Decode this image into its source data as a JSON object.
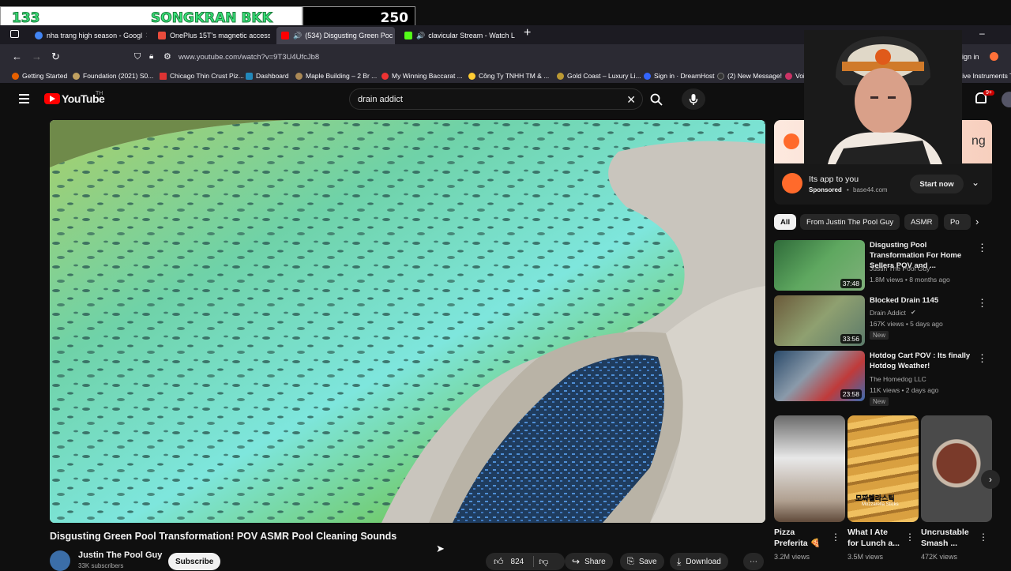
{
  "overlay": {
    "left_number": "133",
    "left_text": "SONGKRAN BKK",
    "right_number": "250"
  },
  "browser": {
    "tabs": [
      {
        "label": "nha trang high season - Googl",
        "color": "#4285f4"
      },
      {
        "label": "OnePlus 15T's magnetic access",
        "color": "#e94b3c"
      },
      {
        "label": "(534) Disgusting Green Poc",
        "color": "#ff0000"
      },
      {
        "label": "clavicular Stream - Watch L",
        "color": "#53fc18"
      }
    ],
    "url": "www.youtube.com/watch?v=9T3U4UfcJb8",
    "sign_in": "Sign in",
    "bookmarks": [
      {
        "label": "Getting Started",
        "color": "#e66000"
      },
      {
        "label": "Foundation (2021) S0...",
        "color": "#c0a060"
      },
      {
        "label": "Chicago Thin Crust Piz...",
        "color": "#d33"
      },
      {
        "label": "Dashboard",
        "color": "#28b"
      },
      {
        "label": "Maple Building – 2 Br ...",
        "color": "#a85"
      },
      {
        "label": "My Winning Baccarat ...",
        "color": "#e33"
      },
      {
        "label": "Công Ty TNHH TM & ...",
        "color": "#fc3"
      },
      {
        "label": "Gold Coast – Luxury Li...",
        "color": "#b93"
      },
      {
        "label": "Sign in · DreamHost",
        "color": "#36f"
      },
      {
        "label": "(2) New Message!",
        "color": "#333"
      },
      {
        "label": "Voice (Korean Dr...",
        "color": "#c36"
      },
      {
        "label": "Native Instruments T",
        "color": "#444"
      }
    ]
  },
  "youtube": {
    "logo": "YouTube",
    "logo_sup": "TH",
    "search_value": "drain addict",
    "notifications_badge": "9+"
  },
  "video": {
    "title": "Disgusting Green Pool Transformation! POV ASMR Pool Cleaning Sounds",
    "channel": "Justin The Pool Guy",
    "subscribers": "33K subscribers",
    "subscribe_label": "Subscribe",
    "like_count": "824",
    "share_label": "Share",
    "save_label": "Save",
    "download_label": "Download"
  },
  "ad": {
    "headline": "Its app to you",
    "sponsored": "Sponsored",
    "domain": "base44.com",
    "cta": "Start now",
    "banner_text": "ng"
  },
  "chips": [
    "All",
    "From Justin The Pool Guy",
    "ASMR",
    "Po"
  ],
  "recommendations": [
    {
      "title": "Disgusting Pool Transformation For Home Sellers POV and ...",
      "channel": "Justin The Pool Guy",
      "meta": "1.8M views • 8 months ago",
      "duration": "37:48",
      "new": ""
    },
    {
      "title": "Blocked Drain 1145",
      "channel": "Drain Addict",
      "meta": "167K views • 5 days ago",
      "duration": "33:56",
      "new": "New"
    },
    {
      "title": "Hotdog Cart POV : Its finally Hotdog Weather!",
      "channel": "The Homedog LLC",
      "meta": "11K views • 2 days ago",
      "duration": "23:58",
      "new": "New"
    }
  ],
  "shorts": [
    {
      "title_line1": "Pizza",
      "title_line2": "Preferita 🍕",
      "views": "3.2M views",
      "overlay": ""
    },
    {
      "title_line1": "What I Ate",
      "title_line2": "for Lunch a...",
      "views": "3.5M views",
      "overlay": "모짜렐라스틱"
    },
    {
      "title_line1": "Uncrustable",
      "title_line2": "Smash ...",
      "views": "472K views",
      "overlay": ""
    }
  ],
  "shorts_overlay_sub": "Mozzarella Sticks"
}
